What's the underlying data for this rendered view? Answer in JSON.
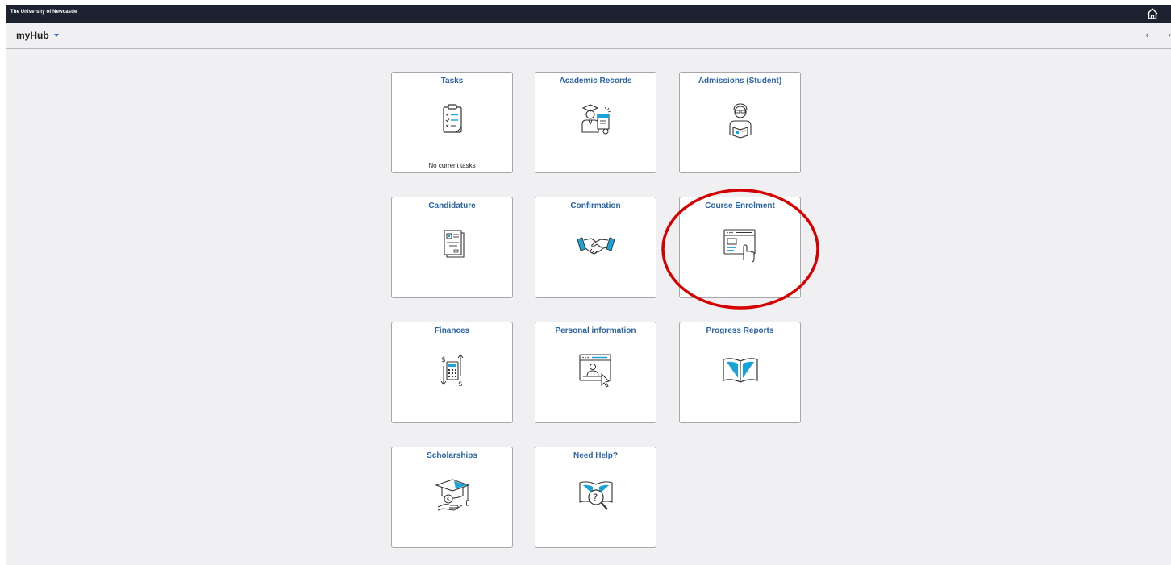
{
  "header": {
    "brand": "The University of Newcastle",
    "home_icon": "home-icon"
  },
  "subheader": {
    "title": "myHub",
    "prev_arrow": "‹",
    "next_arrow": "›"
  },
  "tiles": [
    {
      "title": "Tasks",
      "status": "No current tasks",
      "icon": "clipboard-checklist-icon"
    },
    {
      "title": "Academic Records",
      "icon": "graduate-certificate-icon"
    },
    {
      "title": "Admissions (Student)",
      "icon": "student-reading-icon"
    },
    {
      "title": "Candidature",
      "icon": "document-stack-icon"
    },
    {
      "title": "Confirmation",
      "icon": "handshake-icon"
    },
    {
      "title": "Course Enrolment",
      "icon": "browser-click-icon"
    },
    {
      "title": "Finances",
      "icon": "money-transfer-icon"
    },
    {
      "title": "Personal information",
      "icon": "profile-window-icon"
    },
    {
      "title": "Progress Reports",
      "icon": "open-book-icon"
    },
    {
      "title": "Scholarships",
      "icon": "scholarship-cap-icon"
    },
    {
      "title": "Need Help?",
      "icon": "help-book-icon"
    }
  ],
  "colors": {
    "tile_title": "#2a63a6",
    "accent": "#1aa3d6",
    "annotation": "#d40000"
  }
}
